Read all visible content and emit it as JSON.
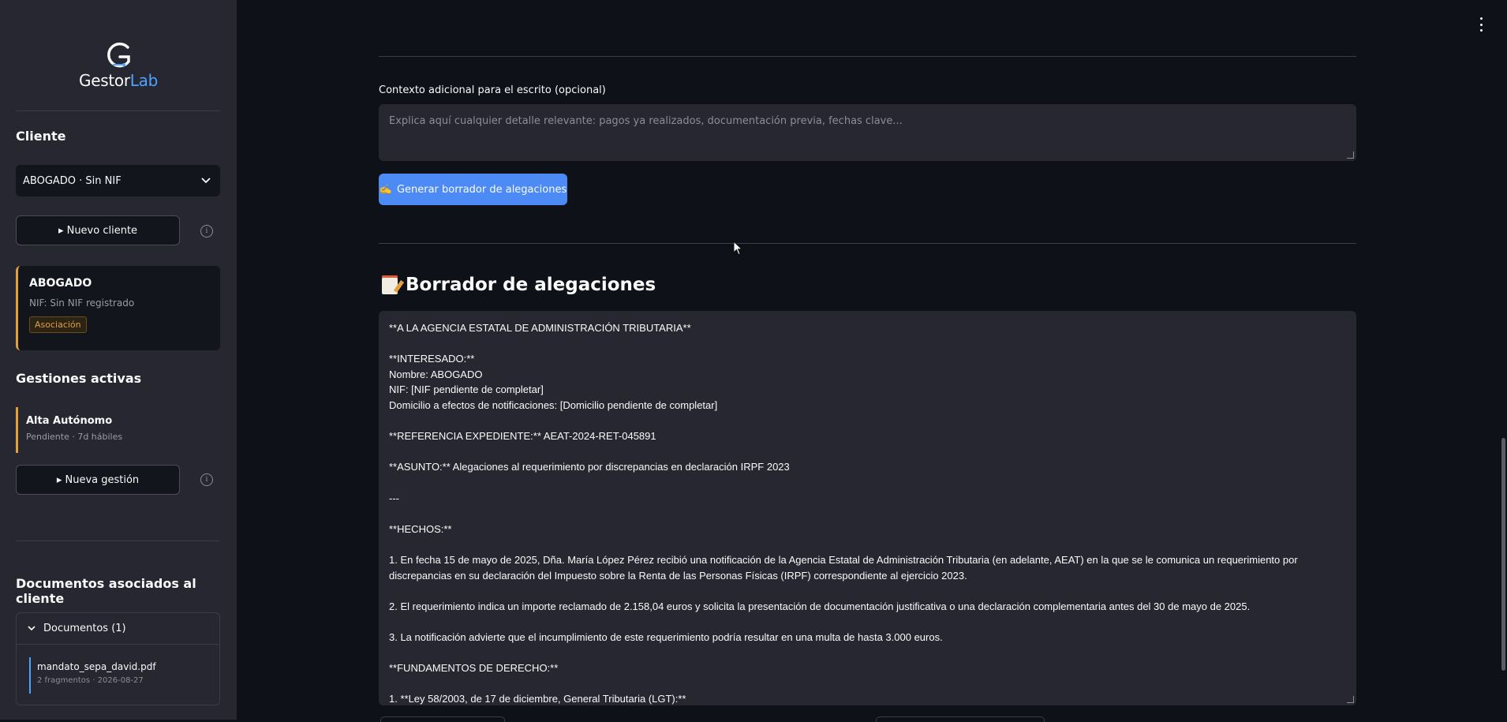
{
  "sidebar": {
    "logo": {
      "text_main": "Gestor",
      "text_accent": "Lab",
      "letter": "G"
    },
    "cliente_heading": "Cliente",
    "client_select": {
      "value": "ABOGADO · Sin NIF",
      "icon": "chevron-down-icon"
    },
    "nuevo_cliente_button": "▸ Nuevo cliente",
    "client_card": {
      "name": "ABOGADO",
      "nif": "NIF: Sin NIF registrado",
      "badge": "Asociación"
    },
    "gestiones_heading": "Gestiones activas",
    "gestion": {
      "title": "Alta Autónomo",
      "subtitle": "Pendiente · 7d hábiles"
    },
    "nueva_gestion_button": "▸ Nueva gestión",
    "documentos_heading": "Documentos asociados al cliente",
    "documentos_expander": "Documentos (1)",
    "document": {
      "name": "mandato_sepa_david.pdf",
      "meta": "2 fragmentos · 2026-08-27"
    },
    "info_icon": "i"
  },
  "main": {
    "context_label": "Contexto adicional para el escrito (opcional)",
    "context_placeholder": "Explica aquí cualquier detalle relevante: pagos ya realizados, documentación previa, fechas clave...",
    "generate_button": {
      "icon": "✍️",
      "label": "Generar borrador de alegaciones"
    },
    "draft_title": "Borrador de alegaciones",
    "draft_lines": [
      "**A LA AGENCIA ESTATAL DE ADMINISTRACIÓN TRIBUTARIA**",
      "",
      "**INTERESADO:**",
      "Nombre: ABOGADO",
      "NIF: [NIF pendiente de completar]",
      "Domicilio a efectos de notificaciones: [Domicilio pendiente de completar]",
      "",
      "**REFERENCIA EXPEDIENTE:** AEAT-2024-RET-045891",
      "",
      "**ASUNTO:** Alegaciones al requerimiento por discrepancias en declaración IRPF 2023",
      "",
      "---",
      "",
      "**HECHOS:**",
      "",
      "1. En fecha 15 de mayo de 2025, Dña. María López Pérez recibió una notificación de la Agencia Estatal de Administración Tributaria (en adelante, AEAT) en la que se le comunica un requerimiento por",
      "discrepancias en su declaración del Impuesto sobre la Renta de las Personas Físicas (IRPF) correspondiente al ejercicio 2023.",
      "",
      "2. El requerimiento indica un importe reclamado de 2.158,04 euros y solicita la presentación de documentación justificativa o una declaración complementaria antes del 30 de mayo de 2025.",
      "",
      "3. La notificación advierte que el incumplimiento de este requerimiento podría resultar en una multa de hasta 3.000 euros.",
      "",
      "**FUNDAMENTOS DE DERECHO:**",
      "",
      "1. **Ley 58/2003, de 17 de diciembre, General Tributaria (LGT):**"
    ]
  }
}
